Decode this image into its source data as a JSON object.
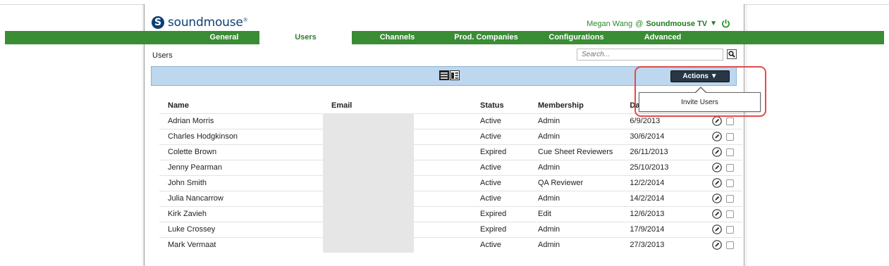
{
  "brand": {
    "logo_text": "soundmouse",
    "logo_mark": "S",
    "registered": "®",
    "color": "#0d3f73"
  },
  "user": {
    "name": "Megan Wang",
    "separator": "@",
    "org": "Soundmouse TV",
    "dropdown_symbol": "▼"
  },
  "nav": {
    "tabs": [
      {
        "label": "General",
        "active": false
      },
      {
        "label": "Users",
        "active": true
      },
      {
        "label": "Channels",
        "active": false
      },
      {
        "label": "Prod. Companies",
        "active": false
      },
      {
        "label": "Configurations",
        "active": false
      },
      {
        "label": "Advanced",
        "active": false
      }
    ],
    "color": "#3a8c35"
  },
  "page": {
    "title": "Users"
  },
  "search": {
    "placeholder": "Search..."
  },
  "toolbar": {
    "actions_label": "Actions ▼",
    "view_modes": [
      "list-view-icon",
      "detail-view-icon"
    ]
  },
  "actions_menu": {
    "items": [
      "Invite Users"
    ]
  },
  "table": {
    "headers": [
      "Name",
      "Email",
      "Status",
      "Membership",
      "Date Cre"
    ],
    "rows": [
      {
        "name": "Adrian Morris",
        "status": "Active",
        "membership": "Admin",
        "date": "6/9/2013"
      },
      {
        "name": "Charles Hodgkinson",
        "status": "Active",
        "membership": "Admin",
        "date": "30/6/2014"
      },
      {
        "name": "Colette Brown",
        "status": "Expired",
        "membership": "Cue Sheet Reviewers",
        "date": "26/11/2013"
      },
      {
        "name": "Jenny Pearman",
        "status": "Active",
        "membership": "Admin",
        "date": "25/10/2013"
      },
      {
        "name": "John Smith",
        "status": "Active",
        "membership": "QA Reviewer",
        "date": "12/2/2014"
      },
      {
        "name": "Julia Nancarrow",
        "status": "Active",
        "membership": "Admin",
        "date": "14/2/2014"
      },
      {
        "name": "Kirk Zavieh",
        "status": "Expired",
        "membership": "Edit",
        "date": "12/6/2013"
      },
      {
        "name": "Luke Crossey",
        "status": "Expired",
        "membership": "Admin",
        "date": "17/9/2014"
      },
      {
        "name": "Mark Vermaat",
        "status": "Active",
        "membership": "Admin",
        "date": "27/3/2013"
      }
    ]
  },
  "highlight_color": "#e24b4b"
}
